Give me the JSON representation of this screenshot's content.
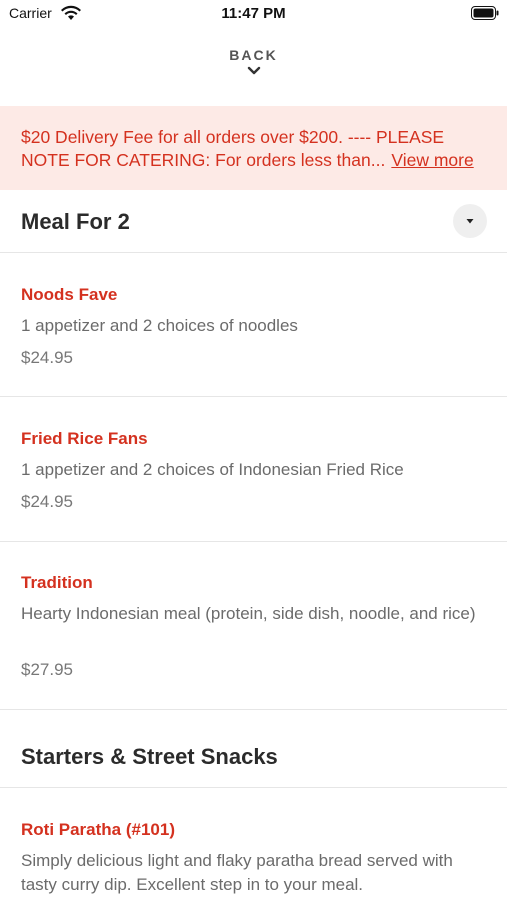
{
  "status_bar": {
    "carrier": "Carrier",
    "time": "11:47 PM"
  },
  "nav": {
    "back_label": "BACK"
  },
  "banner": {
    "text": "$20 Delivery Fee for all orders over $200. ---- PLEASE NOTE FOR CATERING: For orders less than...",
    "link": "View more"
  },
  "sections": [
    {
      "title": "Meal For 2",
      "items": [
        {
          "name": "Noods Fave",
          "description": "1 appetizer and 2 choices of noodles",
          "price": "$24.95"
        },
        {
          "name": "Fried Rice Fans",
          "description": "1 appetizer and 2 choices of Indonesian Fried Rice",
          "price": "$24.95"
        },
        {
          "name": "Tradition",
          "description": "Hearty Indonesian meal (protein, side dish, noodle, and rice)",
          "price": "$27.95"
        }
      ]
    },
    {
      "title": "Starters & Street Snacks",
      "items": [
        {
          "name": "Roti Paratha (#101)",
          "description": "Simply delicious light and flaky paratha bread served with tasty curry dip. Excellent step in to your meal.",
          "price": ""
        }
      ]
    }
  ],
  "colors": {
    "accent": "#d4311f",
    "banner_bg": "#fdeae6",
    "muted_text": "#6b6b6b"
  },
  "icons": {
    "wifi": "wifi-icon",
    "battery": "battery-icon",
    "back": "chevron-down-icon",
    "collapse": "caret-down-icon"
  }
}
